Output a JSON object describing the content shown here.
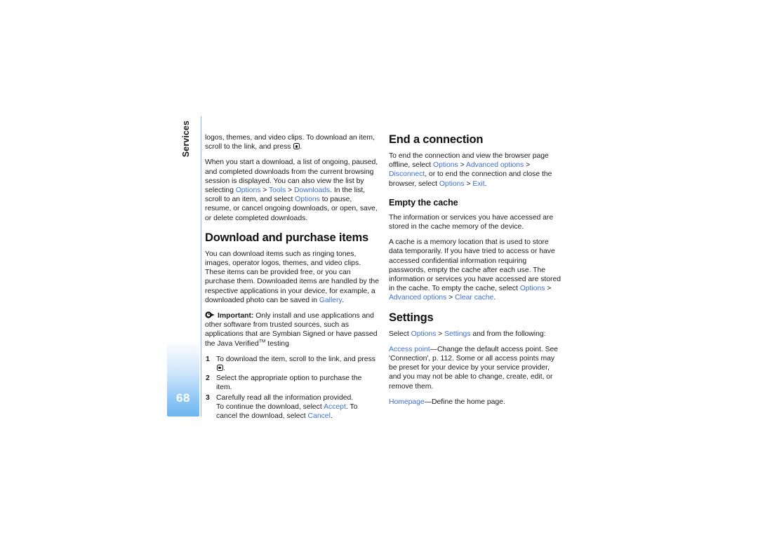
{
  "page": {
    "number": "68",
    "chapter": "Services"
  },
  "left_column": {
    "para_continued": {
      "text_1": "logos, themes, and video clips. To download an item, scroll to the link, and press ",
      "icon": "scroll-key-icon",
      "text_2": "."
    },
    "para_downloads": {
      "text_1": "When you start a download, a list of ongoing, paused, and completed downloads from the current browsing session is displayed. You can also view the list by selecting ",
      "link_1": "Options",
      "sep_1": " > ",
      "link_2": "Tools",
      "sep_2": " > ",
      "link_3": "Downloads",
      "text_2": ". In the list, scroll to an item, and select ",
      "link_4": "Options",
      "text_3": " to pause, resume, or cancel ongoing downloads, or open, save, or delete completed downloads."
    },
    "heading_download": "Download and purchase items",
    "para_purchase": {
      "text_1": "You can download items such as ringing tones, images, operator logos, themes, and video clips. These items can be provided free, or you can purchase them. Downloaded items are handled by the respective applications in your device, for example, a downloaded photo can be saved in ",
      "link_1": "Gallery",
      "text_2": "."
    },
    "note": {
      "icon": "important-pointer-icon",
      "label": "Important:",
      "text_1": " Only install and use applications and other software from trusted sources, such as applications that are Symbian Signed or have passed the Java Verified",
      "tm": "TM",
      "text_2": " testing"
    },
    "steps": [
      {
        "num": "1",
        "text_1": "To download the item, scroll to the link, and press ",
        "icon": "scroll-key-icon",
        "text_2": "."
      },
      {
        "num": "2",
        "text_1": "Select the appropriate option to purchase the item.",
        "text_2": ""
      },
      {
        "num": "3",
        "text_1": "Carefully read all the information provided.",
        "cont_text_1": "To continue the download, select ",
        "cont_link_1": "Accept",
        "cont_text_2": ". To cancel the download, select ",
        "cont_link_2": "Cancel",
        "cont_text_3": "."
      }
    ]
  },
  "right_column": {
    "heading_end_connection": "End a connection",
    "para_end_connection": {
      "text_1": "To end the connection and view the browser page offline, select ",
      "link_1": "Options",
      "sep_1": " > ",
      "link_2": "Advanced options",
      "sep_2": " > ",
      "link_3": "Disconnect",
      "text_2": ", or to end the connection and close the browser, select ",
      "link_4": "Options",
      "sep_3": " > ",
      "link_5": "Exit",
      "text_3": "."
    },
    "subheading_cache": "Empty the cache",
    "para_cache_1": "The information or services you have accessed are stored in the cache memory of the device.",
    "para_cache_2": {
      "text_1": "A cache is a memory location that is used to store data temporarily. If you have tried to access or have accessed confidential information requiring passwords, empty the cache after each use. The information or services you have accessed are stored in the cache. To empty the cache, select ",
      "link_1": "Options",
      "sep_1": " > ",
      "link_2": "Advanced options",
      "sep_2": " > ",
      "link_3": "Clear cache",
      "text_2": "."
    },
    "heading_settings": "Settings",
    "para_settings_intro": {
      "text_1": "Select ",
      "link_1": "Options",
      "sep_1": " > ",
      "link_2": "Settings",
      "text_2": " and from the following:"
    },
    "para_access_point": {
      "link_1": "Access point",
      "text_1": "—Change the default access point. See 'Connection', p. 112. Some or all access points may be preset for your device by your service provider, and you may not be able to change, create, edit, or remove them."
    },
    "para_homepage": {
      "link_1": "Homepage",
      "text_1": "—Define the home page."
    }
  },
  "colors": {
    "link": "#3f6fd0",
    "tab_blue": "#6cb5f0",
    "rule": "#8fb4d9"
  }
}
